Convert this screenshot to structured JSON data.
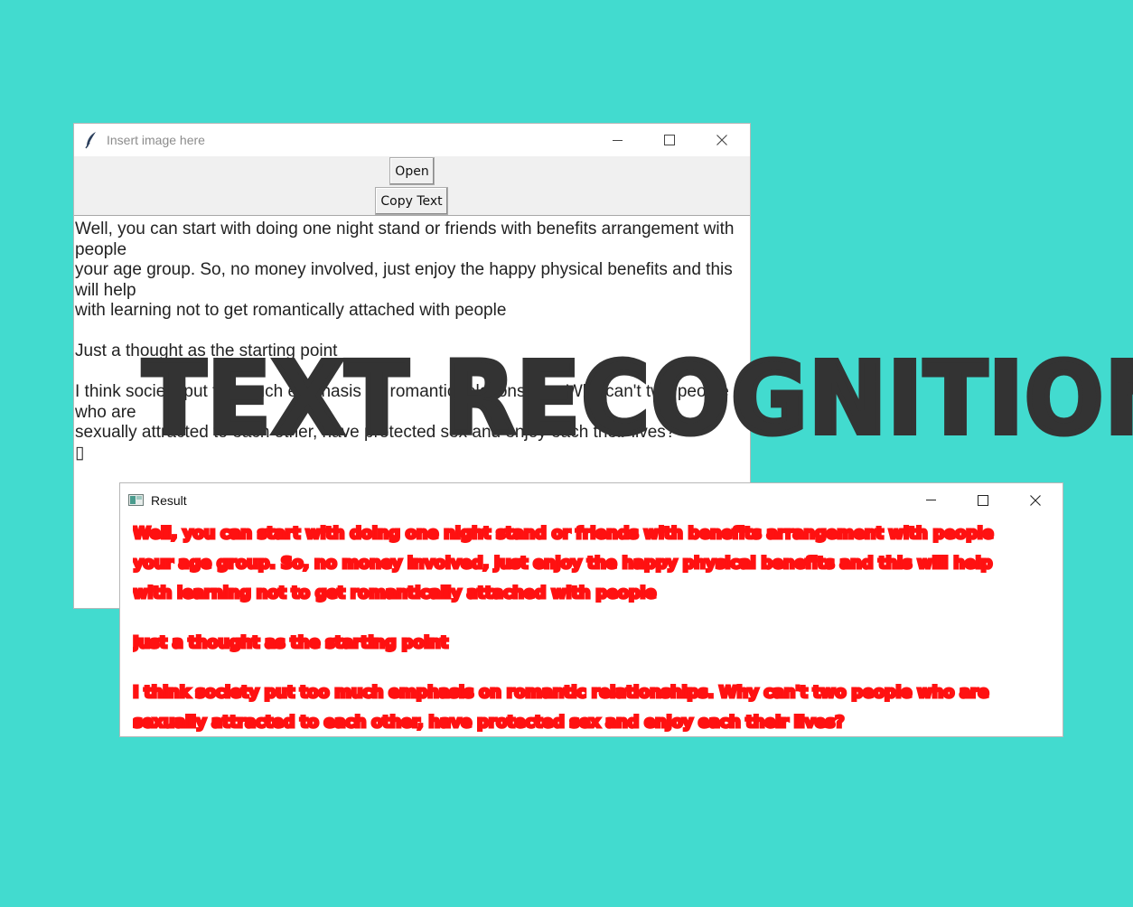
{
  "main_window": {
    "title": "Insert image here",
    "app_icon": "feather-icon",
    "open_label": "Open",
    "copy_label": "Copy Text",
    "text_lines": [
      "Well, you can start with doing one night stand or friends with benefits arrangement with",
      "people",
      "your age group. So, no money involved, just enjoy the happy physical benefits and this",
      "will help",
      "with learning not to get romantically attached with people",
      "",
      "Just a thought as the starting point",
      "",
      "I think society put too much emphasis on romantic relationships. Why can't two people",
      "who are",
      "sexually attracted to each other, have protected sex and enjoy each their lives?",
      "▯"
    ]
  },
  "result_window": {
    "title": "Result",
    "app_icon": "image-window-icon",
    "lines": [
      "Well, you can start with doing one night stand or friends with benefits arrangement with people",
      "your age group. So, no money involved, just enjoy the happy physical benefits and this will help",
      "with learning not to get romantically attached with people",
      "",
      "Just a thought as the starting point",
      "",
      "I think society put too much emphasis on romantic relationships. Why can't two people who are",
      "sexually attracted to each other, have protected sex and enjoy each their lives?"
    ]
  },
  "overlay_title": "TEXT RECOGNITION",
  "window_controls": [
    "minimize-icon",
    "maximize-icon",
    "close-icon"
  ],
  "colors": {
    "background": "#42dbcf",
    "overlay_text": "#333333",
    "highlight": "#ff1111"
  }
}
